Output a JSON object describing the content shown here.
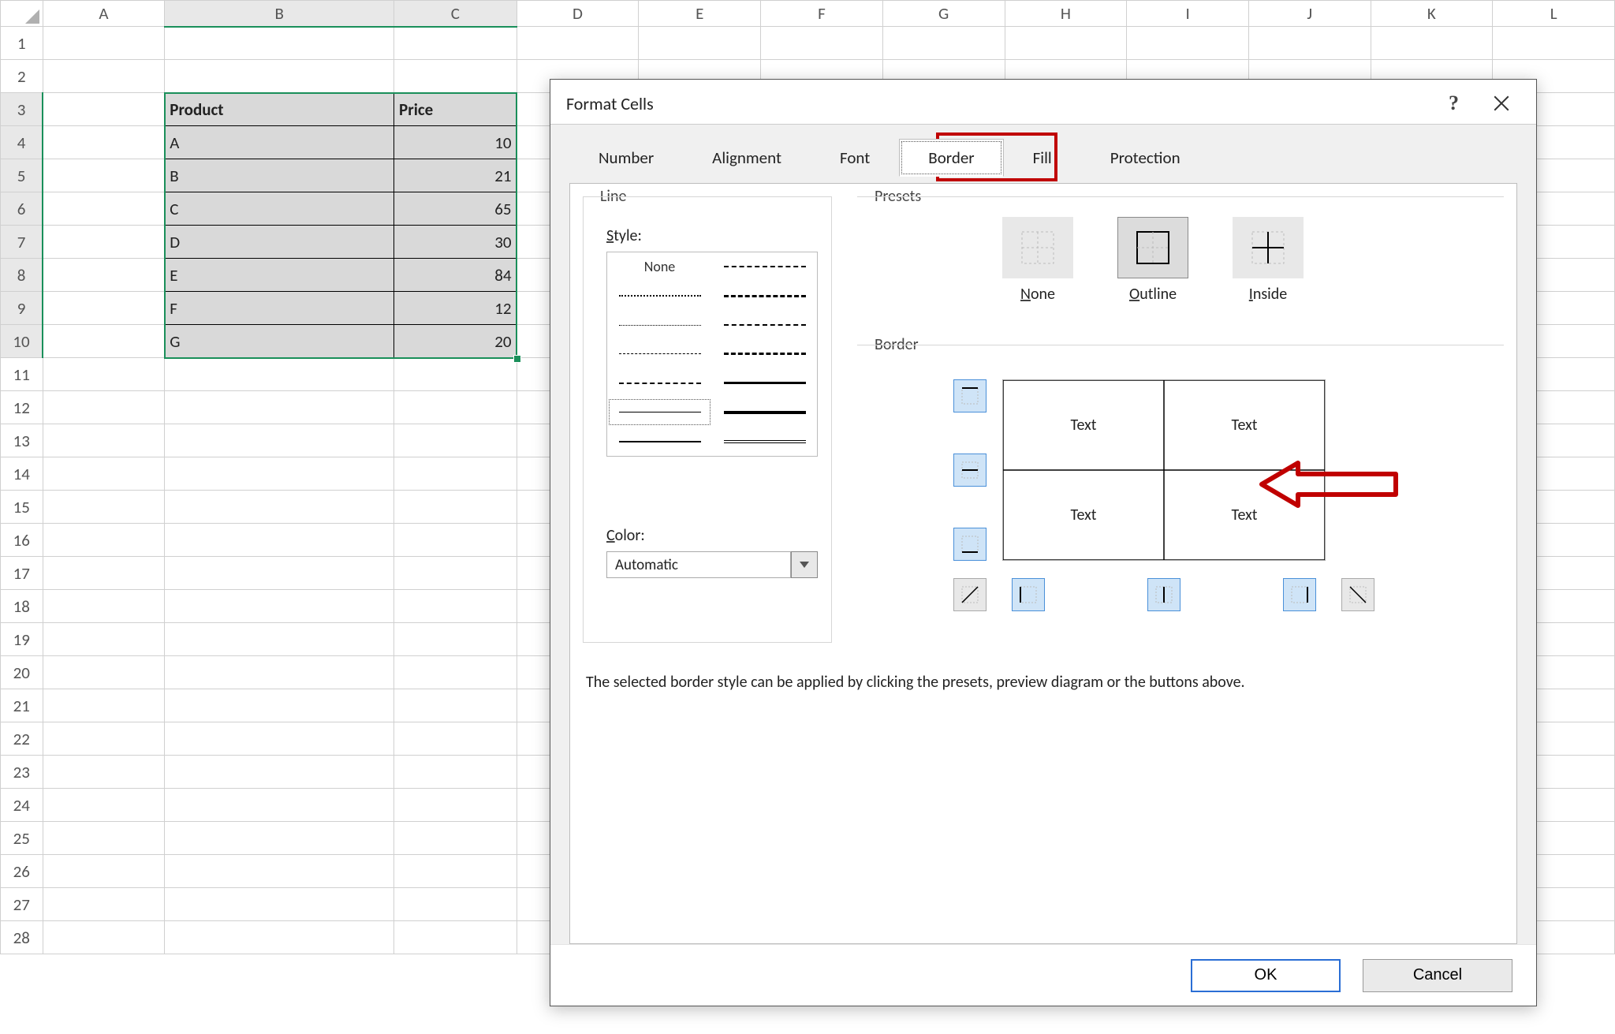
{
  "sheet": {
    "columns": [
      "A",
      "B",
      "C",
      "D",
      "E",
      "F",
      "G",
      "H",
      "I",
      "J",
      "K",
      "L"
    ],
    "rows": 28,
    "data": {
      "headers": [
        "Product",
        "Price"
      ],
      "rowsData": [
        {
          "product": "A",
          "price": "10"
        },
        {
          "product": "B",
          "price": "21"
        },
        {
          "product": "C",
          "price": "65"
        },
        {
          "product": "D",
          "price": "30"
        },
        {
          "product": "E",
          "price": "84"
        },
        {
          "product": "F",
          "price": "12"
        },
        {
          "product": "G",
          "price": "20"
        }
      ]
    }
  },
  "dialog": {
    "title": "Format Cells",
    "help_icon": "?",
    "tabs": [
      "Number",
      "Alignment",
      "Font",
      "Border",
      "Fill",
      "Protection"
    ],
    "active_tab": "Border",
    "line_group": "Line",
    "style_label": "Style:",
    "style_none": "None",
    "color_label": "Color:",
    "color_value": "Automatic",
    "presets_group": "Presets",
    "preset_none": "None",
    "preset_outline": "Outline",
    "preset_inside": "Inside",
    "border_group": "Border",
    "preview_text": "Text",
    "hint": "The selected border style can be applied by clicking the presets, preview diagram or the buttons above.",
    "ok": "OK",
    "cancel": "Cancel"
  }
}
